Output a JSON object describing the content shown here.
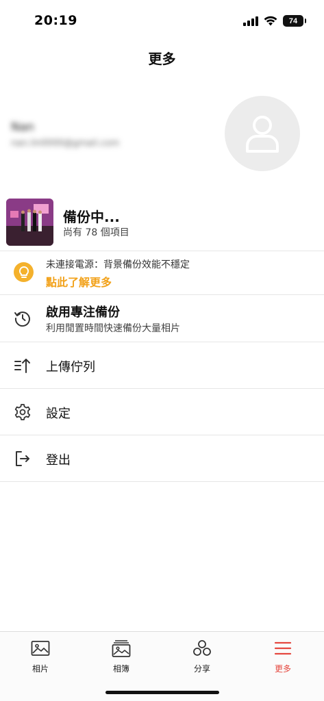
{
  "status_bar": {
    "time": "20:19",
    "battery": "74",
    "icons": [
      "cellular-signal-icon",
      "wifi-icon",
      "battery-icon"
    ]
  },
  "header": {
    "title": "更多"
  },
  "profile": {
    "name": "Nan",
    "email": "nan.lin0000@gmail.com",
    "avatar_icon": "person-icon"
  },
  "backup": {
    "title": "備份中...",
    "subtitle": "尚有 78 個項目"
  },
  "notice": {
    "icon": "lightbulb-icon",
    "text": "未連接電源：背景備份效能不穩定",
    "link": "點此了解更多",
    "accent_color": "#f2a21b"
  },
  "focus_backup": {
    "icon": "history-icon",
    "title": "啟用專注備份",
    "subtitle": "利用閒置時間快速備份大量相片"
  },
  "menu": {
    "upload_queue": {
      "label": "上傳佇列",
      "icon": "upload-queue-icon"
    },
    "settings": {
      "label": "設定",
      "icon": "gear-icon"
    },
    "logout": {
      "label": "登出",
      "icon": "logout-icon"
    }
  },
  "tabbar": {
    "active_color": "#e5483f",
    "tabs": [
      {
        "label": "相片",
        "icon": "photo-icon",
        "active": false
      },
      {
        "label": "相簿",
        "icon": "album-icon",
        "active": false
      },
      {
        "label": "分享",
        "icon": "share-icon",
        "active": false
      },
      {
        "label": "更多",
        "icon": "menu-icon",
        "active": true
      }
    ]
  }
}
